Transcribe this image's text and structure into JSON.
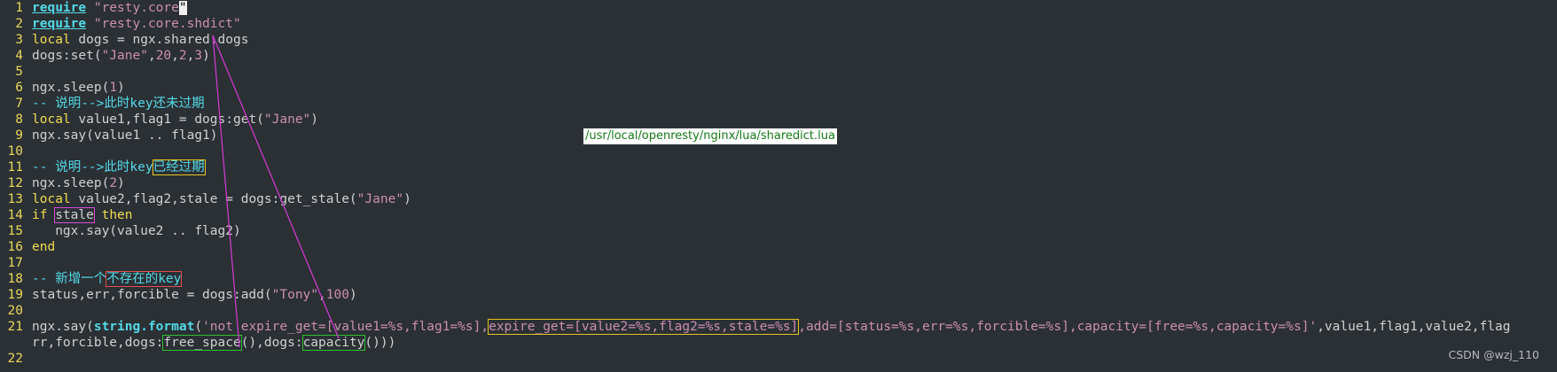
{
  "editor": {
    "lines": [
      {
        "num": "1",
        "parts": [
          {
            "t": "require",
            "c": "req"
          },
          {
            "t": " "
          },
          {
            "t": "\"resty.core",
            "c": "str"
          },
          {
            "t": "\"",
            "c": "cursor"
          }
        ]
      },
      {
        "num": "2",
        "parts": [
          {
            "t": "require",
            "c": "req"
          },
          {
            "t": " "
          },
          {
            "t": "\"resty.core.shdict\"",
            "c": "str"
          }
        ]
      },
      {
        "num": "3",
        "parts": [
          {
            "t": "local",
            "c": "kw"
          },
          {
            "t": " dogs = ngx.shared.dogs"
          }
        ]
      },
      {
        "num": "4",
        "parts": [
          {
            "t": "dogs:set("
          },
          {
            "t": "\"Jane\"",
            "c": "str"
          },
          {
            "t": ","
          },
          {
            "t": "20",
            "c": "num"
          },
          {
            "t": ","
          },
          {
            "t": "2",
            "c": "num"
          },
          {
            "t": ","
          },
          {
            "t": "3",
            "c": "num"
          },
          {
            "t": ")"
          }
        ]
      },
      {
        "num": "5",
        "parts": []
      },
      {
        "num": "6",
        "parts": [
          {
            "t": "ngx.sleep("
          },
          {
            "t": "1",
            "c": "num"
          },
          {
            "t": ")"
          }
        ]
      },
      {
        "num": "7",
        "parts": [
          {
            "t": "-- 说明-->此时key还未过期",
            "c": "cmt"
          }
        ]
      },
      {
        "num": "8",
        "parts": [
          {
            "t": "local",
            "c": "kw"
          },
          {
            "t": " value1,flag1 = dogs:get("
          },
          {
            "t": "\"Jane\"",
            "c": "str"
          },
          {
            "t": ")"
          }
        ]
      },
      {
        "num": "9",
        "parts": [
          {
            "t": "ngx.say(value1 .. flag1)"
          }
        ]
      },
      {
        "num": "10",
        "parts": []
      },
      {
        "num": "11",
        "parts": [
          {
            "t": "-- 说明-->此时key",
            "c": "cmt"
          },
          {
            "t": "已经过期",
            "c": "cmt box box-yellow"
          }
        ]
      },
      {
        "num": "12",
        "parts": [
          {
            "t": "ngx.sleep("
          },
          {
            "t": "2",
            "c": "num"
          },
          {
            "t": ")"
          }
        ]
      },
      {
        "num": "13",
        "parts": [
          {
            "t": "local",
            "c": "kw"
          },
          {
            "t": " value2,flag2,stale = dogs:get_stale("
          },
          {
            "t": "\"Jane\"",
            "c": "str"
          },
          {
            "t": ")"
          }
        ]
      },
      {
        "num": "14",
        "parts": [
          {
            "t": "if",
            "c": "kw"
          },
          {
            "t": " "
          },
          {
            "t": "stale",
            "c": "box box-pink"
          },
          {
            "t": " "
          },
          {
            "t": "then",
            "c": "kw"
          }
        ]
      },
      {
        "num": "15",
        "parts": [
          {
            "t": "   ngx.say(value2 .. flag2)"
          }
        ]
      },
      {
        "num": "16",
        "parts": [
          {
            "t": "end",
            "c": "kw"
          }
        ]
      },
      {
        "num": "17",
        "parts": []
      },
      {
        "num": "18",
        "parts": [
          {
            "t": "-- 新增一个",
            "c": "cmt"
          },
          {
            "t": "不存在的key",
            "c": "cmt box box-red"
          }
        ]
      },
      {
        "num": "19",
        "parts": [
          {
            "t": "status,err,forcible = dogs:add("
          },
          {
            "t": "\"Tony\"",
            "c": "str"
          },
          {
            "t": ","
          },
          {
            "t": "100",
            "c": "num"
          },
          {
            "t": ")"
          }
        ]
      },
      {
        "num": "20",
        "parts": []
      },
      {
        "num": "21",
        "parts": [
          {
            "t": "ngx.say("
          },
          {
            "t": "string.format",
            "c": "fn"
          },
          {
            "t": "("
          },
          {
            "t": "'not expire_get=[value1=%s,flag1=%s],",
            "c": "str"
          },
          {
            "t": "expire_get=[value2=%s,flag2=%s,stale=%s]",
            "c": "str box box-yellow"
          },
          {
            "t": ",add=[status=%s,err=%s,forcible=%s],capacity=[free=%s,capacity=%s]'",
            "c": "str"
          },
          {
            "t": ",value1,flag1,value2,flag"
          }
        ]
      },
      {
        "num": "",
        "parts": [
          {
            "t": "rr,forcible,dogs:"
          },
          {
            "t": "free_space",
            "c": "box box-green"
          },
          {
            "t": "(),dogs:"
          },
          {
            "t": "capacity",
            "c": "box box-green"
          },
          {
            "t": "()))"
          }
        ]
      },
      {
        "num": "22",
        "parts": []
      }
    ]
  },
  "annotation": {
    "path_label": "/usr/local/openresty/nginx/lua/sharedict.lua",
    "line_color": "#d63ad6"
  },
  "watermark": "CSDN @wzj_110"
}
